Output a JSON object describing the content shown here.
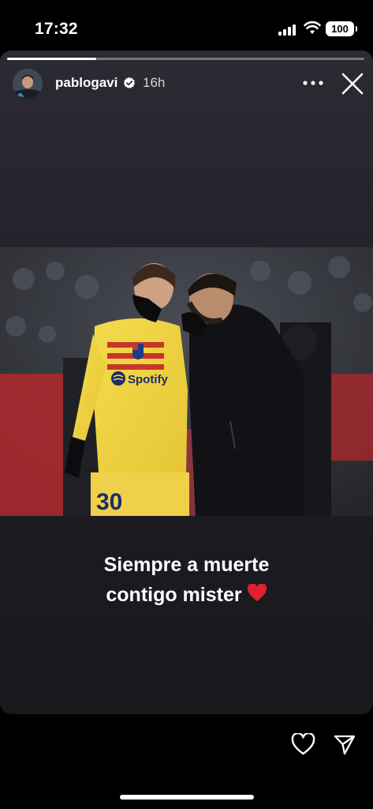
{
  "status_bar": {
    "time": "17:32",
    "battery": "100"
  },
  "story": {
    "progress": 0.25,
    "username": "pablogavi",
    "age": "16h",
    "caption_line1": "Siempre a muerte",
    "caption_line2": "contigo mister",
    "photo_jersey_sponsor": "Spotify",
    "photo_jersey_number": "30"
  },
  "icons": {
    "signal": "signal-icon",
    "wifi": "wifi-icon",
    "battery": "battery-icon",
    "verified": "verified-badge-icon",
    "more": "more-horizontal-icon",
    "close": "close-icon",
    "heart": "heart-emoji",
    "like": "heart-outline-icon",
    "share": "send-icon"
  },
  "colors": {
    "background": "#000000",
    "card_top": "#2c2a33",
    "card_bottom": "#18181d",
    "heart": "#e0202e"
  }
}
